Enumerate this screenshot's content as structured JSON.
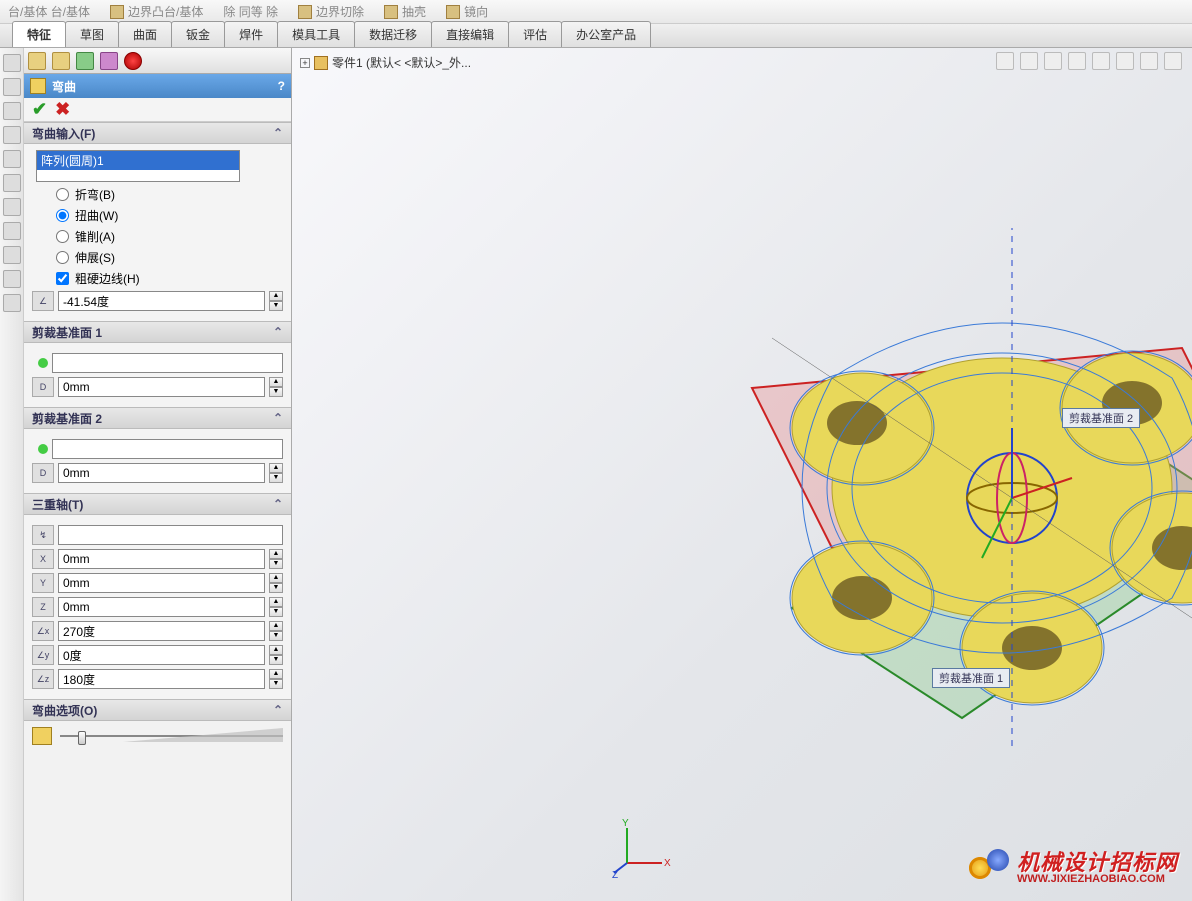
{
  "top_toolbar": {
    "items": [
      "台/基体  台/基体",
      "边界凸台/基体",
      "除     同等     除",
      "边界切除",
      "抽壳",
      "镜向"
    ]
  },
  "tabs": [
    "特征",
    "草图",
    "曲面",
    "钣金",
    "焊件",
    "模具工具",
    "数据迁移",
    "直接编辑",
    "评估",
    "办公室产品"
  ],
  "active_tab": 0,
  "breadcrumb": "零件1  (默认< <默认>_外...",
  "panel": {
    "title": "弯曲",
    "help": "?",
    "sections": {
      "input": {
        "title": "弯曲输入(F)",
        "selected_item": "阵列(圆周)1",
        "radios": {
          "bend": "折弯(B)",
          "twist": "扭曲(W)",
          "taper": "锥削(A)",
          "stretch": "伸展(S)"
        },
        "radio_checked": "twist",
        "checkbox": {
          "label": "粗硬边线(H)",
          "checked": true
        },
        "angle": "-41.54度"
      },
      "trim1": {
        "title": "剪裁基准面 1",
        "field1": "",
        "field2": "0mm"
      },
      "trim2": {
        "title": "剪裁基准面 2",
        "field1": "",
        "field2": "0mm"
      },
      "triad": {
        "title": "三重轴(T)",
        "origin": "",
        "x": "0mm",
        "y": "0mm",
        "z": "0mm",
        "rx": "270度",
        "ry": "0度",
        "rz": "180度"
      },
      "options": {
        "title": "弯曲选项(O)"
      }
    }
  },
  "labels": {
    "trim_plane_1": "剪裁基准面  1",
    "trim_plane_2": "剪裁基准面  2"
  },
  "axes": {
    "x": "X",
    "y": "Y",
    "z": "Z"
  },
  "watermark": {
    "line1": "机械设计招标网",
    "line2": "WWW.JIXIEZHAOBIAO.COM"
  }
}
